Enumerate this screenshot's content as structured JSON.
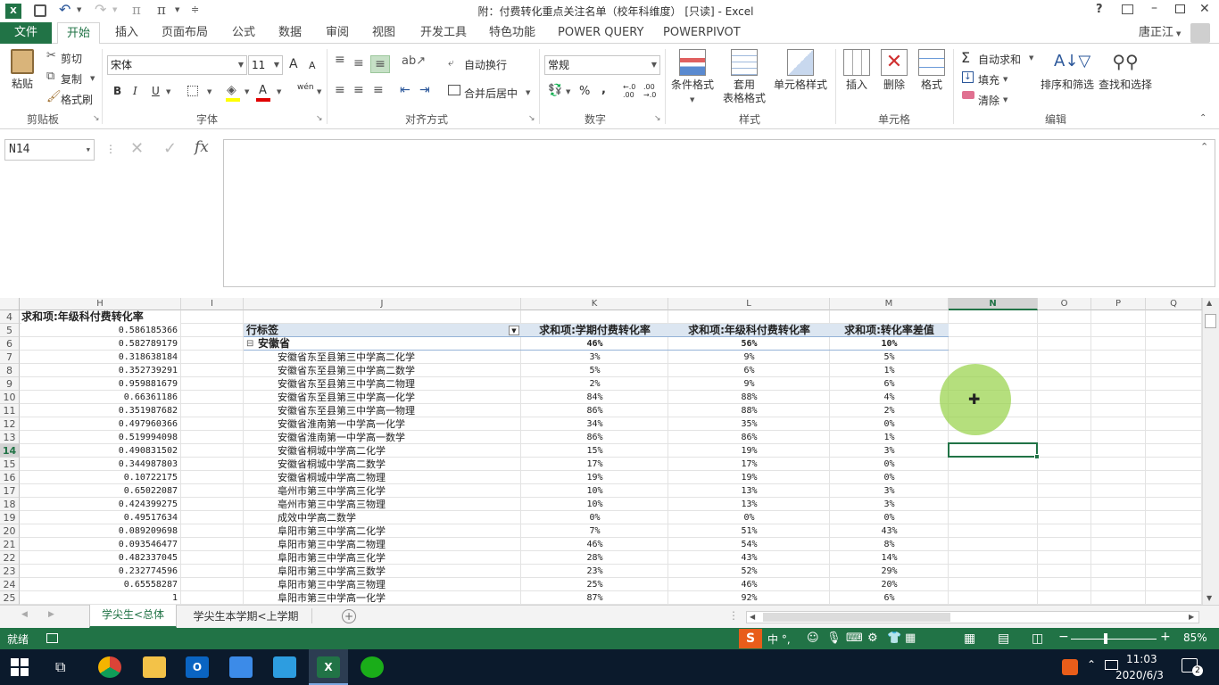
{
  "window": {
    "title": "附：付费转化重点关注名单（校年科维度） [只读] - Excel",
    "help": "?"
  },
  "ribbon_tabs": [
    "文件",
    "开始",
    "插入",
    "页面布局",
    "公式",
    "数据",
    "审阅",
    "视图",
    "开发工具",
    "特色功能",
    "POWER QUERY",
    "POWERPIVOT"
  ],
  "user": "唐正江",
  "clipboard": {
    "paste": "粘贴",
    "cut": "剪切",
    "copy": "复制",
    "format_painter": "格式刷",
    "label": "剪贴板"
  },
  "font": {
    "name": "宋体",
    "size": "11",
    "label": "字体",
    "bold": "B",
    "italic": "I",
    "underline": "U",
    "grow": "A",
    "shrink": "A",
    "phonetic": "wén"
  },
  "alignment": {
    "wrap": "自动换行",
    "merge": "合并后居中",
    "label": "对齐方式"
  },
  "number": {
    "format": "常规",
    "percent": "%",
    "comma": ",",
    "label": "数字",
    "inc": "←.0 .00",
    "dec": ".00 →.0"
  },
  "styles": {
    "conditional": "条件格式",
    "table_1": "套用",
    "table_2": "表格格式",
    "cell_styles": "单元格样式",
    "label": "样式"
  },
  "cells": {
    "insert": "插入",
    "delete": "删除",
    "format": "格式",
    "label": "单元格"
  },
  "editing": {
    "autosum": "自动求和",
    "fill": "填充",
    "clear": "清除",
    "sort": "排序和筛选",
    "find": "查找和选择",
    "label": "编辑"
  },
  "formula_bar": {
    "name_box": "N14",
    "fx": "fx",
    "value": ""
  },
  "columns": [
    "H",
    "I",
    "J",
    "K",
    "L",
    "M",
    "N",
    "O",
    "P",
    "Q"
  ],
  "pivot_headers": {
    "row4_h": "求和项:年级科付费转化率",
    "row_label": "行标签",
    "k": "求和项:学期付费转化率",
    "l": "求和项:年级科付费转化率",
    "m": "求和项:转化率差值"
  },
  "group": {
    "name": "安徽省",
    "k": "46%",
    "l": "56%",
    "m": "10%",
    "toggle": "⊟"
  },
  "rows": [
    {
      "r": "4",
      "h": "",
      "j": "",
      "k": "",
      "l": "",
      "m": ""
    },
    {
      "r": "5",
      "h": "0.586185366",
      "j": "",
      "k": "",
      "l": "",
      "m": ""
    },
    {
      "r": "6",
      "h": "0.582789179",
      "j": "",
      "k": "",
      "l": "",
      "m": ""
    },
    {
      "r": "7",
      "h": "0.318638184",
      "j": "安徽省东至县第三中学高二化学",
      "k": "3%",
      "l": "9%",
      "m": "5%"
    },
    {
      "r": "8",
      "h": "0.352739291",
      "j": "安徽省东至县第三中学高二数学",
      "k": "5%",
      "l": "6%",
      "m": "1%"
    },
    {
      "r": "9",
      "h": "0.959881679",
      "j": "安徽省东至县第三中学高二物理",
      "k": "2%",
      "l": "9%",
      "m": "6%"
    },
    {
      "r": "10",
      "h": "0.66361186",
      "j": "安徽省东至县第三中学高一化学",
      "k": "84%",
      "l": "88%",
      "m": "4%"
    },
    {
      "r": "11",
      "h": "0.351987682",
      "j": "安徽省东至县第三中学高一物理",
      "k": "86%",
      "l": "88%",
      "m": "2%"
    },
    {
      "r": "12",
      "h": "0.497960366",
      "j": "安徽省淮南第一中学高一化学",
      "k": "34%",
      "l": "35%",
      "m": "0%"
    },
    {
      "r": "13",
      "h": "0.519994098",
      "j": "安徽省淮南第一中学高一数学",
      "k": "86%",
      "l": "86%",
      "m": "1%"
    },
    {
      "r": "14",
      "h": "0.490831502",
      "j": "安徽省桐城中学高二化学",
      "k": "15%",
      "l": "19%",
      "m": "3%"
    },
    {
      "r": "15",
      "h": "0.344987803",
      "j": "安徽省桐城中学高二数学",
      "k": "17%",
      "l": "17%",
      "m": "0%"
    },
    {
      "r": "16",
      "h": "0.10722175",
      "j": "安徽省桐城中学高二物理",
      "k": "19%",
      "l": "19%",
      "m": "0%"
    },
    {
      "r": "17",
      "h": "0.65022087",
      "j": "亳州市第三中学高三化学",
      "k": "10%",
      "l": "13%",
      "m": "3%"
    },
    {
      "r": "18",
      "h": "0.424399275",
      "j": "亳州市第三中学高三物理",
      "k": "10%",
      "l": "13%",
      "m": "3%"
    },
    {
      "r": "19",
      "h": "0.49517634",
      "j": "成效中学高二数学",
      "k": "0%",
      "l": "0%",
      "m": "0%"
    },
    {
      "r": "20",
      "h": "0.089209698",
      "j": "阜阳市第三中学高二化学",
      "k": "7%",
      "l": "51%",
      "m": "43%"
    },
    {
      "r": "21",
      "h": "0.093546477",
      "j": "阜阳市第三中学高二物理",
      "k": "46%",
      "l": "54%",
      "m": "8%"
    },
    {
      "r": "22",
      "h": "0.482337045",
      "j": "阜阳市第三中学高三化学",
      "k": "28%",
      "l": "43%",
      "m": "14%"
    },
    {
      "r": "23",
      "h": "0.232774596",
      "j": "阜阳市第三中学高三数学",
      "k": "23%",
      "l": "52%",
      "m": "29%"
    },
    {
      "r": "24",
      "h": "0.65558287",
      "j": "阜阳市第三中学高三物理",
      "k": "25%",
      "l": "46%",
      "m": "20%"
    },
    {
      "r": "25",
      "h": "1",
      "j": "阜阳市第三中学高一化学",
      "k": "87%",
      "l": "92%",
      "m": "6%"
    }
  ],
  "sheets": [
    "学尖生<总体",
    "学尖生本学期<上学期"
  ],
  "status": {
    "ready": "就绪",
    "zoom": "85%"
  },
  "taskbar": {
    "time": "11:03",
    "date": "2020/6/3",
    "notif": "2"
  },
  "ime": "中 °,",
  "colors": {
    "excel_green": "#217346",
    "selection": "#217346",
    "pivot_header": "#dce6f1"
  }
}
